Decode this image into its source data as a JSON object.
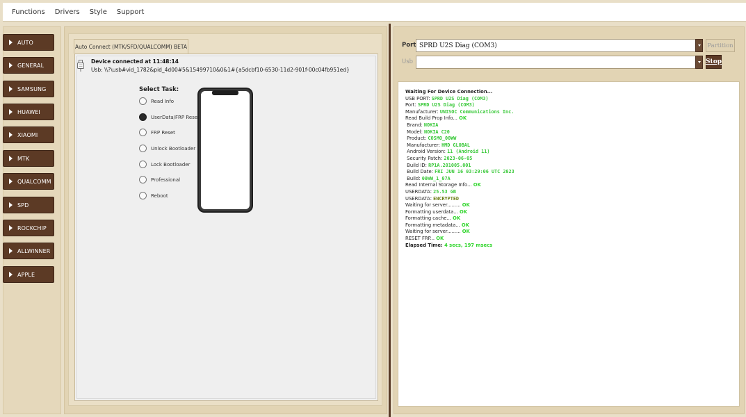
{
  "menubar": {
    "items": [
      "Functions",
      "Drivers",
      "Style",
      "Support"
    ]
  },
  "sidebar": {
    "items": [
      {
        "label": "AUTO"
      },
      {
        "label": "GENERAL"
      },
      {
        "label": "SAMSUNG"
      },
      {
        "label": "HUAWEI"
      },
      {
        "label": "XIAOMI"
      },
      {
        "label": "MTK"
      },
      {
        "label": "QUALCOMM"
      },
      {
        "label": "SPD"
      },
      {
        "label": "ROCKCHIP"
      },
      {
        "label": "ALLWINNER"
      },
      {
        "label": "APPLE"
      }
    ]
  },
  "main": {
    "tab_label": "Auto Connect (MTK/SFD/QUALCOMM) BETA",
    "device_connected": "Device connected at 11:48:14",
    "usb_path": "Usb: \\\\?\\usb#vid_1782&pid_4d00#5&15499710&0&1#{a5dcbf10-6530-11d2-901f-00c04fb951ed}",
    "select_task_label": "Select Task:",
    "tasks": [
      {
        "label": "Read Info",
        "selected": false
      },
      {
        "label": "UserData/FRP Reset",
        "selected": true
      },
      {
        "label": "FRP Reset",
        "selected": false
      },
      {
        "label": "Unlock Bootloader",
        "selected": false
      },
      {
        "label": "Lock Bootloader",
        "selected": false
      },
      {
        "label": "Professional",
        "selected": false
      },
      {
        "label": "Reboot",
        "selected": false
      }
    ]
  },
  "right": {
    "port_label": "Port",
    "port_value": "SPRD U2S Diag (COM3)",
    "usb_label": "Usb",
    "usb_value": "",
    "partition_button": "Partition",
    "stop_button": "Stop"
  },
  "log": {
    "waiting": "Waiting For Device Connection...",
    "usb_port_label": "USB PORT:",
    "usb_port_value": "SPRD U2S Diag (COM3)",
    "port_label": "Port:",
    "port_value": "SPRD U2S Diag (COM3)",
    "manufacturer_label": "Manufacturer:",
    "manufacturer_value": "UNISOC Communications Inc.",
    "read_build_label": "Read Build Prop Info...",
    "read_build_status": "OK",
    "brand_label": "Brand:",
    "brand_value": "NOKIA",
    "model_label": "Model:",
    "model_value": "NOKIA C20",
    "product_label": "Product:",
    "product_value": "COSMO_00WW",
    "manufacturer2_label": "Manufacturer:",
    "manufacturer2_value": "HMD GLOBAL",
    "android_label": "Android Version:",
    "android_value": "11 (Android 11)",
    "patch_label": "Security Patch:",
    "patch_value": "2023-06-05",
    "buildid_label": "Build ID:",
    "buildid_value": "RP1A.201005.001",
    "builddate_label": "Build Date:",
    "builddate_value": "FRI JUN 16 03:29:06 UTC 2023",
    "build_label": "Build:",
    "build_value": "00WW_1_07A",
    "storage_label": "Read Internal Storage Info...",
    "storage_status": "OK",
    "userdata1_label": "USERDATA:",
    "userdata1_value": "25.53 GB",
    "userdata2_label": "USERDATA:",
    "userdata2_value": "ENCRYPTED",
    "wait1_label": "Waiting for server.........",
    "wait1_status": "OK",
    "fmt_userdata_label": "Formatting userdata...",
    "fmt_userdata_status": "OK",
    "fmt_cache_label": "Formatting cache...",
    "fmt_cache_status": "OK",
    "fmt_meta_label": "Formatting metadata...",
    "fmt_meta_status": "OK",
    "wait2_label": "Waiting for server.........",
    "wait2_status": "OK",
    "reset_frp_label": "RESET FRP...",
    "reset_frp_status": "OK",
    "elapsed_label": "Elapsed Time:",
    "elapsed_value": "4 secs, 197 msecs"
  },
  "colors": {
    "brown_button": "#5c3a25",
    "panel_bg": "#e2d4b4",
    "ok_green": "#32d62e"
  }
}
